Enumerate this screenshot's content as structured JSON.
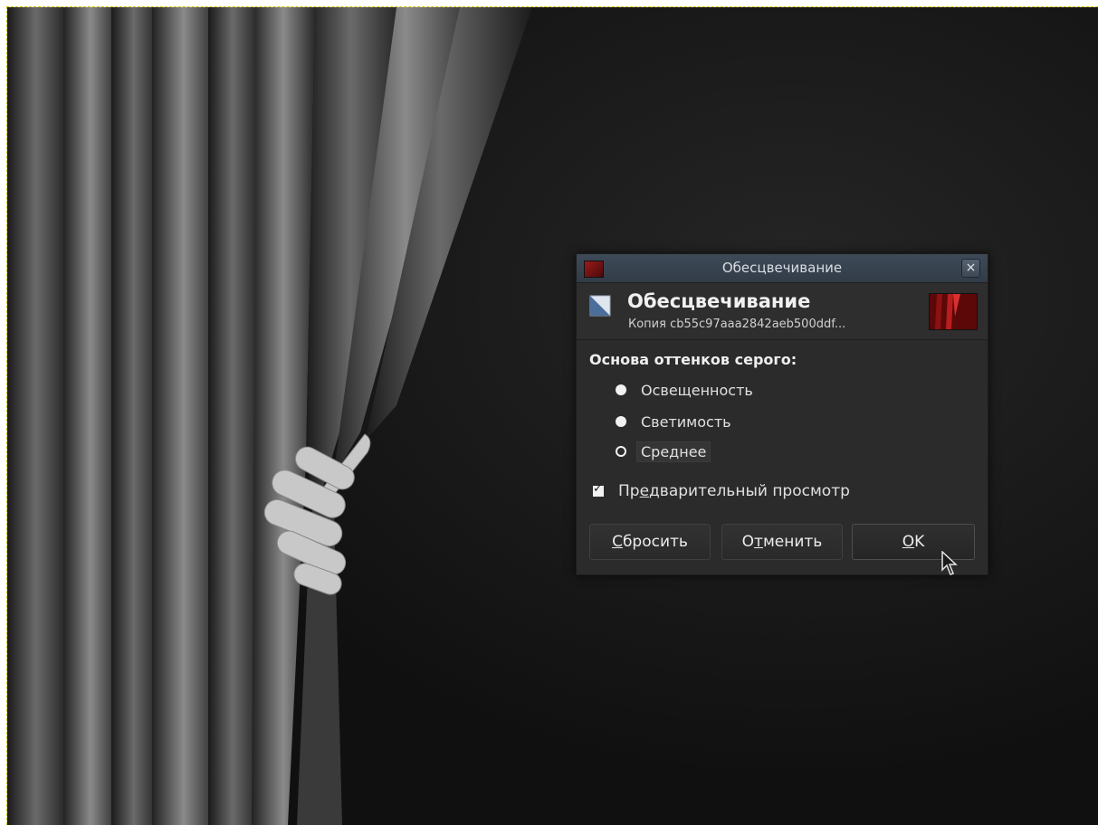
{
  "dialog": {
    "window_title": "Обесцвечивание",
    "close_glyph": "×",
    "filter_name": "Обесцвечивание",
    "image_name": "Копия cb55c97aaa2842aeb500ddf...",
    "section_label": "Основа оттенков серого:",
    "options": [
      {
        "label": "Освещенность",
        "selected": true
      },
      {
        "label": "Светимость",
        "selected": true
      },
      {
        "label": "Среднее",
        "selected": false
      }
    ],
    "preview": {
      "label_pre": "Пр",
      "label_u": "е",
      "label_post": "дварительный просмотр",
      "checked": true
    },
    "buttons": {
      "reset_u": "С",
      "reset_rest": "бросить",
      "cancel_pre": "О",
      "cancel_u": "т",
      "cancel_rest": "менить",
      "ok_u": "O",
      "ok_rest": "K"
    }
  },
  "colors": {
    "canvas_bg": "#131313",
    "dialog_bg": "#2b2b2b",
    "titlebar": "#3a4552",
    "selection_border": "#d4c400"
  },
  "icons": {
    "app": "gimp-image-icon",
    "filter": "desaturate-icon",
    "close": "close-icon",
    "pointer": "mouse-pointer-icon"
  }
}
